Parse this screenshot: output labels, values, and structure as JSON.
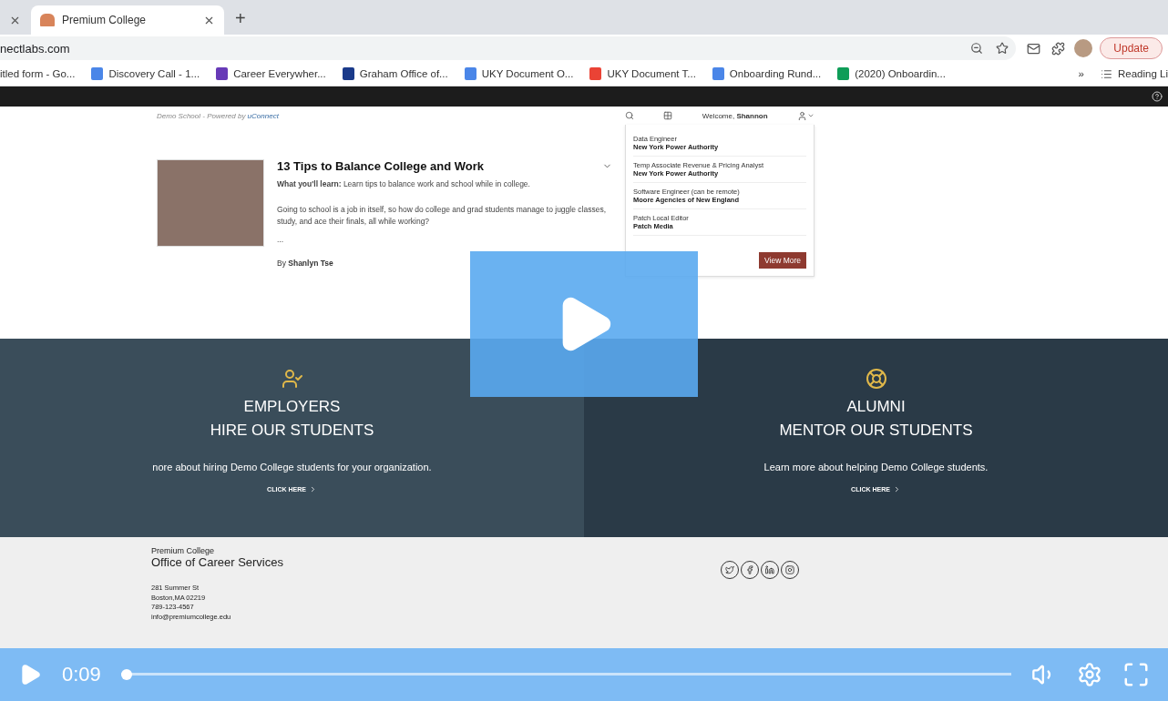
{
  "browser": {
    "tabs": [
      {
        "selected": false
      },
      {
        "title": "Premium College",
        "selected": true
      }
    ],
    "new_tab": "+",
    "address": "nectlabs.com",
    "update_button": "Update",
    "bookmarks": [
      {
        "kind": "plain",
        "label": "itled form - Go..."
      },
      {
        "kind": "doc",
        "label": "Discovery Call - 1..."
      },
      {
        "kind": "form",
        "label": "Career Everywher..."
      },
      {
        "kind": "uk",
        "label": "Graham Office of..."
      },
      {
        "kind": "doc",
        "label": "UKY Document O..."
      },
      {
        "kind": "google",
        "label": "UKY Document T..."
      },
      {
        "kind": "doc",
        "label": "Onboarding Rund..."
      },
      {
        "kind": "sheet",
        "label": "(2020) Onboardin..."
      }
    ],
    "more_bookmarks": "»",
    "reading_list": "Reading Li"
  },
  "site": {
    "brand_prefix": "Demo School - Powered by ",
    "brand_link": "uConnect",
    "welcome": "Welcome, ",
    "user": "Shannon",
    "article": {
      "title": "13 Tips to Balance College and Work",
      "learn_label": "What you'll learn:",
      "learn_text": "Learn tips to balance work and school while in college.",
      "body": "Going to school is a job in itself, so how do college and grad students manage to juggle classes, study, and ace their finals, all while working?",
      "ellipsis": "...",
      "by": "By ",
      "author": "Shanlyn Tse"
    },
    "jobs": [
      {
        "title": "Data Engineer",
        "company": "New York Power Authority"
      },
      {
        "title": "Temp Associate Revenue & Pricing Analyst",
        "company": "New York Power Authority"
      },
      {
        "title": "Software Engineer (can be remote)",
        "company": "Moore Agencies of New England"
      },
      {
        "title": "Patch Local Editor",
        "company": "Patch Media"
      }
    ],
    "view_more": "View More",
    "promos": [
      {
        "kind": "person",
        "line1": "EMPLOYERS",
        "line2": "HIRE OUR STUDENTS",
        "text": "nore about hiring Demo College students for your organization.",
        "cta": "CLICK HERE"
      },
      {
        "kind": "lifebuoy",
        "line1": "ALUMNI",
        "line2": "MENTOR OUR STUDENTS",
        "text": "Learn more about helping Demo College students.",
        "cta": "CLICK HERE"
      }
    ],
    "footer": {
      "org": "Premium College",
      "office": "Office of Career Services",
      "address": [
        "281 Summer St",
        "Boston,MA 02219",
        "789-123-4567",
        "info@premiumcollege.edu"
      ]
    }
  },
  "player": {
    "time": "0:09",
    "progress": {
      "level": 0.0
    }
  }
}
